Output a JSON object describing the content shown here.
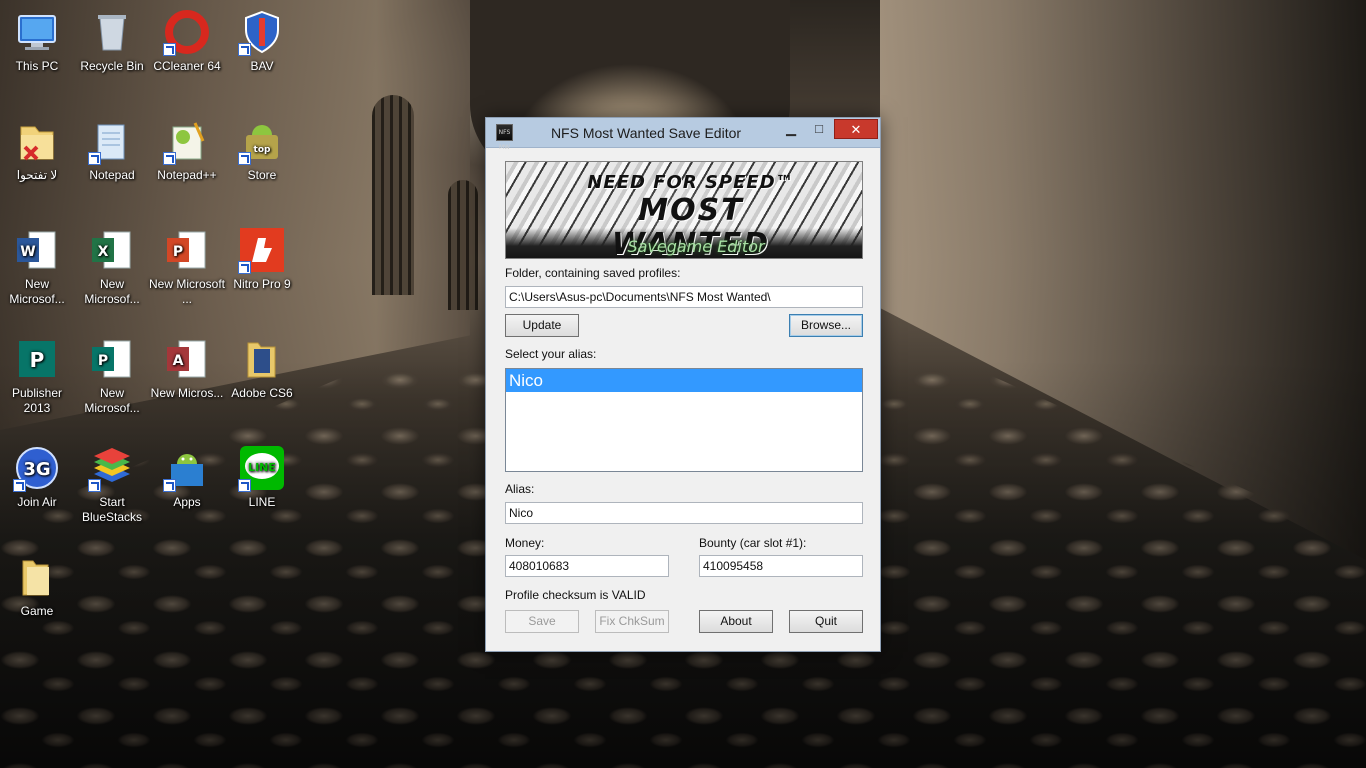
{
  "desktop": {
    "icons": [
      {
        "label": "This PC",
        "icon": "computer-icon"
      },
      {
        "label": "Recycle Bin",
        "icon": "recycle-bin-icon"
      },
      {
        "label": "CCleaner 64",
        "icon": "ccleaner-icon"
      },
      {
        "label": "BAV",
        "icon": "shield-icon"
      },
      {
        "label": "لا تفتحوا",
        "icon": "folder-icon"
      },
      {
        "label": "Notepad",
        "icon": "notepad-icon"
      },
      {
        "label": "Notepad++",
        "icon": "notepadpp-icon"
      },
      {
        "label": "Store",
        "icon": "android-store-icon"
      },
      {
        "label": "New Microsof...",
        "icon": "word-icon"
      },
      {
        "label": "New Microsof...",
        "icon": "excel-icon"
      },
      {
        "label": "New Microsoft ...",
        "icon": "powerpoint-icon"
      },
      {
        "label": "Nitro Pro 9",
        "icon": "nitro-icon"
      },
      {
        "label": "Publisher 2013",
        "icon": "publisher-icon"
      },
      {
        "label": "New Microsof...",
        "icon": "publisher-doc-icon"
      },
      {
        "label": "New Micros...",
        "icon": "access-icon"
      },
      {
        "label": "Adobe CS6",
        "icon": "folder-icon"
      },
      {
        "label": "Join Air",
        "icon": "3g-icon"
      },
      {
        "label": "Start BlueStacks",
        "icon": "bluestacks-icon"
      },
      {
        "label": "Apps",
        "icon": "android-apps-icon"
      },
      {
        "label": "LINE",
        "icon": "line-icon"
      },
      {
        "label": "Game",
        "icon": "folder-icon"
      }
    ]
  },
  "app": {
    "title": "NFS Most Wanted Save Editor",
    "title_icon_text": "NFS MW",
    "controls": {
      "minimize": "▁",
      "maximize": "□",
      "close": "✕"
    },
    "banner": {
      "logo_line1": "NEED FOR SPEED™",
      "logo_line2": "MOST WANTED",
      "subtitle": "Savegame Editor"
    },
    "folder_label": "Folder, containing saved profiles:",
    "folder_path": "C:\\Users\\Asus-pc\\Documents\\NFS Most Wanted\\",
    "update_button": "Update",
    "browse_button": "Browse...",
    "alias_list_label": "Select your alias:",
    "aliases": [
      "Nico"
    ],
    "selected_alias_index": 0,
    "alias_label": "Alias:",
    "alias_value": "Nico",
    "money_label": "Money:",
    "money_value": "408010683",
    "bounty_label": "Bounty (car slot #1):",
    "bounty_value": "410095458",
    "checksum_status": "Profile checksum is VALID",
    "buttons": {
      "save": "Save",
      "fix_checksum": "Fix ChkSum",
      "about": "About",
      "quit": "Quit"
    }
  },
  "colors": {
    "selection": "#3399ff",
    "close_button": "#c8392c",
    "titlebar": "#b7cbe1"
  }
}
